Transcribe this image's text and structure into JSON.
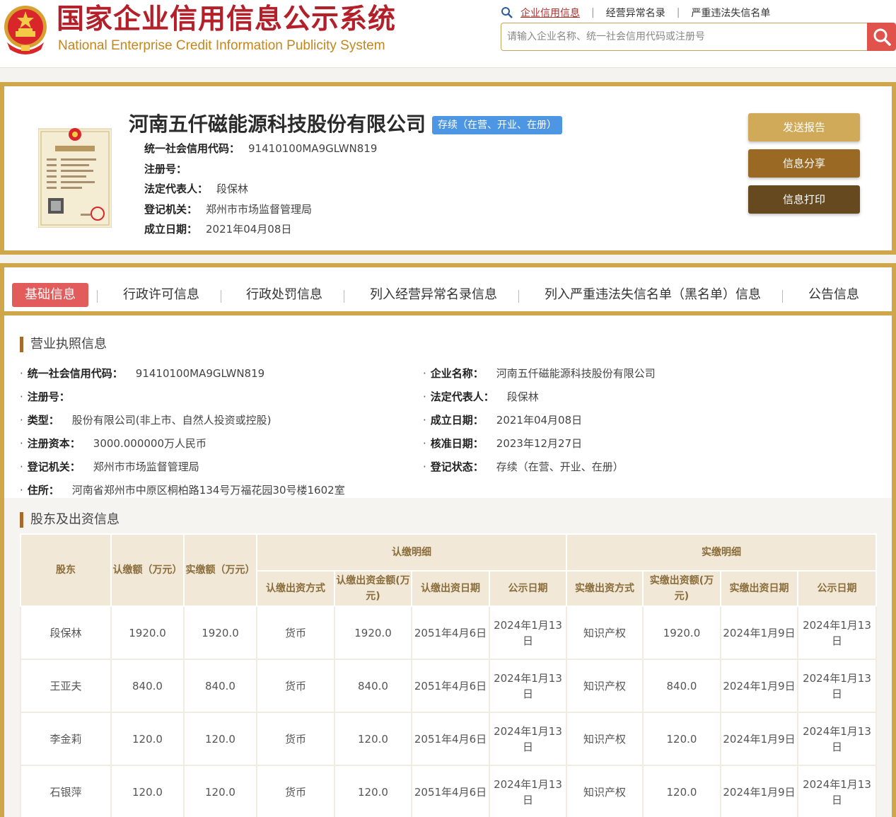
{
  "header": {
    "title_cn": "国家企业信用信息公示系统",
    "title_en": "National Enterprise Credit Information Publicity System",
    "search_tabs": [
      "企业信用信息",
      "经营异常名录",
      "严重违法失信名单"
    ],
    "search_placeholder": "请输入企业名称、统一社会信用代码或注册号"
  },
  "company": {
    "name": "河南五仟磁能源科技股份有限公司",
    "status": "存续（在营、开业、在册）",
    "fields": [
      {
        "label": "统一社会信用代码：",
        "value": "91410100MA9GLWN819"
      },
      {
        "label": "注册号：",
        "value": ""
      },
      {
        "label": "法定代表人：",
        "value": "段保林"
      },
      {
        "label": "登记机关：",
        "value": "郑州市市场监督管理局"
      },
      {
        "label": "成立日期：",
        "value": "2021年04月08日"
      }
    ],
    "buttons": {
      "send": "发送报告",
      "share": "信息分享",
      "print": "信息打印"
    }
  },
  "tabs": [
    "基础信息",
    "行政许可信息",
    "行政处罚信息",
    "列入经营异常名录信息",
    "列入严重违法失信名单（黑名单）信息",
    "公告信息"
  ],
  "license_section": {
    "title": "营业执照信息",
    "left": [
      {
        "label": "统一社会信用代码：",
        "value": "91410100MA9GLWN819"
      },
      {
        "label": "注册号：",
        "value": ""
      },
      {
        "label": "类型：",
        "value": "股份有限公司(非上市、自然人投资或控股)"
      },
      {
        "label": "注册资本：",
        "value": "3000.000000万人民币"
      },
      {
        "label": "登记机关：",
        "value": "郑州市市场监督管理局"
      },
      {
        "label": "住所：",
        "value": "河南省郑州市中原区桐柏路134号万福花园30号楼1602室"
      }
    ],
    "right": [
      {
        "label": "企业名称：",
        "value": "河南五仟磁能源科技股份有限公司"
      },
      {
        "label": "法定代表人：",
        "value": "段保林"
      },
      {
        "label": "成立日期：",
        "value": "2021年04月08日"
      },
      {
        "label": "核准日期：",
        "value": "2023年12月27日"
      },
      {
        "label": "登记状态：",
        "value": "存续（在营、开业、在册）"
      }
    ]
  },
  "shareholder_section": {
    "title": "股东及出资信息",
    "headers": {
      "shareholder": "股东",
      "subscribed": "认缴额（万元）",
      "paid": "实缴额（万元）",
      "subscribed_detail": "认缴明细",
      "paid_detail": "实缴明细",
      "sub_cols": [
        "认缴出资方式",
        "认缴出资金额(万元)",
        "认缴出资日期",
        "公示日期"
      ],
      "paid_cols": [
        "实缴出资方式",
        "实缴出资额(万元)",
        "实缴出资日期",
        "公示日期"
      ]
    },
    "rows": [
      [
        "段保林",
        "1920.0",
        "1920.0",
        "货币",
        "1920.0",
        "2051年4月6日",
        "2024年1月13日",
        "知识产权",
        "1920.0",
        "2024年1月9日",
        "2024年1月13日"
      ],
      [
        "王亚夫",
        "840.0",
        "840.0",
        "货币",
        "840.0",
        "2051年4月6日",
        "2024年1月13日",
        "知识产权",
        "840.0",
        "2024年1月9日",
        "2024年1月13日"
      ],
      [
        "李金莉",
        "120.0",
        "120.0",
        "货币",
        "120.0",
        "2051年4月6日",
        "2024年1月13日",
        "知识产权",
        "120.0",
        "2024年1月9日",
        "2024年1月13日"
      ],
      [
        "石银萍",
        "120.0",
        "120.0",
        "货币",
        "120.0",
        "2051年4月6日",
        "2024年1月13日",
        "知识产权",
        "120.0",
        "2024年1月9日",
        "2024年1月13日"
      ]
    ]
  },
  "colors": {
    "brand_red": "#b4202a",
    "gold": "#cfa64a",
    "tab_active": "#e35c5c",
    "status_blue": "#4d96e3"
  }
}
